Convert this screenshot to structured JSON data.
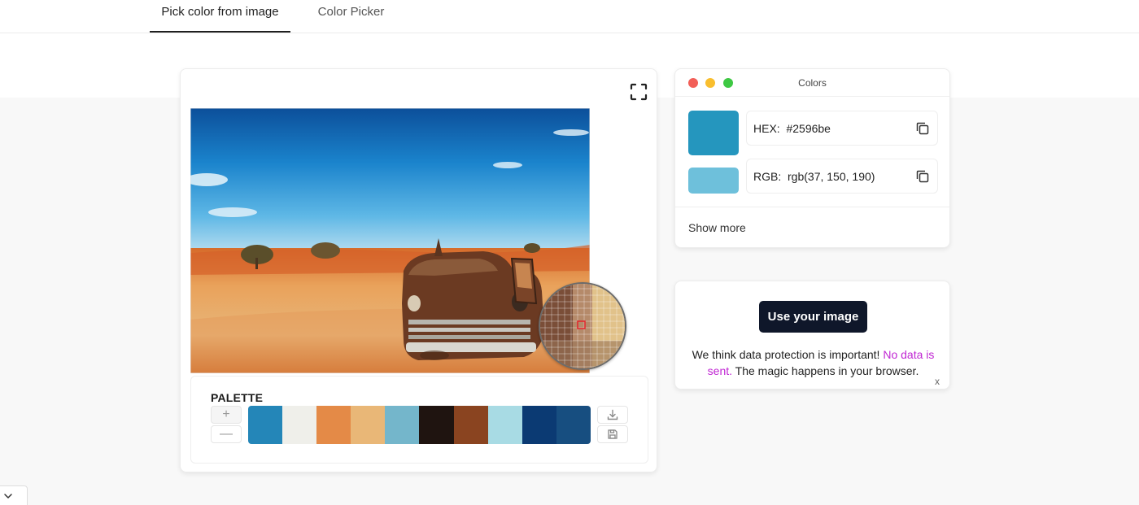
{
  "tabs": [
    {
      "label": "Pick color from image",
      "active": true
    },
    {
      "label": "Color Picker",
      "active": false
    }
  ],
  "image_panel": {
    "fullscreen_icon": "fullscreen-icon",
    "palette": {
      "title": "PALETTE",
      "add_label": "+",
      "remove_label": "—",
      "colors": [
        "#2486b8",
        "#efefea",
        "#e48a47",
        "#e9b777",
        "#74b6cb",
        "#1f1410",
        "#8a4420",
        "#a8dbe4",
        "#0b3a73",
        "#174e80"
      ],
      "download_icon": "download-icon",
      "save_icon": "save-icon"
    }
  },
  "colors_panel": {
    "title": "Colors",
    "primary_color": "#2596be",
    "secondary_color": "#6ec0db",
    "hex_label": "HEX:",
    "hex_value": "#2596be",
    "rgb_label": "RGB:",
    "rgb_value": "rgb(37, 150, 190)",
    "show_more": "Show more"
  },
  "upload_panel": {
    "button_label": "Use your image",
    "text_before": "We think data protection is important!",
    "text_accent": "No data is sent.",
    "text_after": "The magic happens in your browser.",
    "close_label": "x"
  }
}
